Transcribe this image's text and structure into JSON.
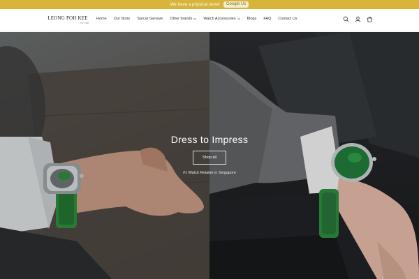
{
  "announcement": {
    "text": "We have a physical store!",
    "button_label": "Google Us"
  },
  "header": {
    "logo_text": "LEONG POH KEE",
    "logo_subtext": "EST. 1968",
    "nav": [
      {
        "label": "Home"
      },
      {
        "label": "Our Story"
      },
      {
        "label": "Sarcar Geneve"
      },
      {
        "label": "Other brands",
        "dropdown": true
      },
      {
        "label": "Watch Accessories",
        "dropdown": true
      },
      {
        "label": "Blogs"
      },
      {
        "label": "FAQ"
      },
      {
        "label": "Contact Us"
      }
    ],
    "icons": [
      "search-icon",
      "account-icon",
      "cart-icon"
    ]
  },
  "hero": {
    "title": "Dress to Impress",
    "button_label": "Shop all",
    "subtitle": "#1 Watch Retailer in Singapore"
  },
  "colors": {
    "announcement_bg": "#d8b53a",
    "watch_strap": "#2f8a3e"
  }
}
